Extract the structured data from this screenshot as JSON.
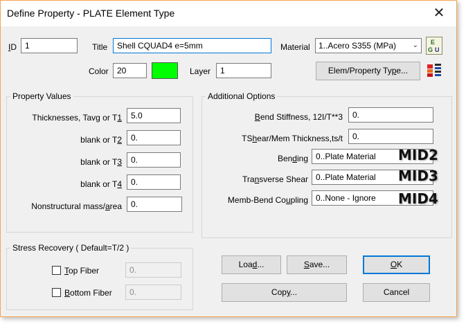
{
  "window": {
    "title": "Define Property - PLATE Element Type",
    "close_label": "✕"
  },
  "header": {
    "id_label_u": "I",
    "id_label_rest": "D",
    "id_value": "1",
    "title_label": "Title",
    "title_value": "Shell CQUAD4 e=5mm",
    "material_label": "Material",
    "material_value": "1..Acero S355 (MPa)",
    "color_label": "Color",
    "color_value": "20",
    "color_swatch": "#00ff00",
    "layer_label": "Layer",
    "layer_value": "1",
    "elem_button_pre": "Elem/Property Ty",
    "elem_button_u": "p",
    "elem_button_post": "e..."
  },
  "property_values": {
    "group_title": "Property Values",
    "rows": [
      {
        "label_pre": "Thicknesses, Tavg or T",
        "label_u": "1",
        "label_post": "",
        "value": "5.0"
      },
      {
        "label_pre": "blank or T",
        "label_u": "2",
        "label_post": "",
        "value": "0."
      },
      {
        "label_pre": "blank or T",
        "label_u": "3",
        "label_post": "",
        "value": "0."
      },
      {
        "label_pre": "blank or T",
        "label_u": "4",
        "label_post": "",
        "value": "0."
      },
      {
        "label_pre": "Nonstructural mass/",
        "label_u": "a",
        "label_post": "rea",
        "value": "0."
      }
    ]
  },
  "additional_options": {
    "group_title": "Additional Options",
    "bend_stiffness_pre": "",
    "bend_stiffness_u": "B",
    "bend_stiffness_post": "end Stiffness,  12I/T**3",
    "bend_stiffness_value": "0.",
    "tshear_pre": "TS",
    "tshear_u": "h",
    "tshear_post": "ear/Mem Thickness,ts/t",
    "tshear_value": "0.",
    "bending_pre": "Ben",
    "bending_u": "d",
    "bending_post": "ing",
    "bending_value": "0..Plate Material",
    "bending_mid": "MID2",
    "transverse_pre": "Tra",
    "transverse_u": "n",
    "transverse_post": "sverse Shear",
    "transverse_value": "0..Plate Material",
    "transverse_mid": "MID3",
    "coupling_pre": "Memb-Bend Co",
    "coupling_u": "u",
    "coupling_post": "pling",
    "coupling_value": "0..None - Ignore",
    "coupling_mid": "MID4"
  },
  "stress_recovery": {
    "group_title": "Stress Recovery ( Default=T/2 )",
    "top_fiber_label_u": "T",
    "top_fiber_label_rest": "op Fiber",
    "top_fiber_value": "0.",
    "bottom_fiber_label_u": "B",
    "bottom_fiber_label_rest": "ottom Fiber",
    "bottom_fiber_value": "0."
  },
  "buttons": {
    "load_pre": "Loa",
    "load_u": "d",
    "load_post": "...",
    "save_pre": "",
    "save_u": "S",
    "save_post": "ave...",
    "ok_pre": "",
    "ok_u": "O",
    "ok_post": "K",
    "copy_pre": "Cop",
    "copy_u": "y",
    "copy_post": "...",
    "cancel": "Cancel"
  }
}
